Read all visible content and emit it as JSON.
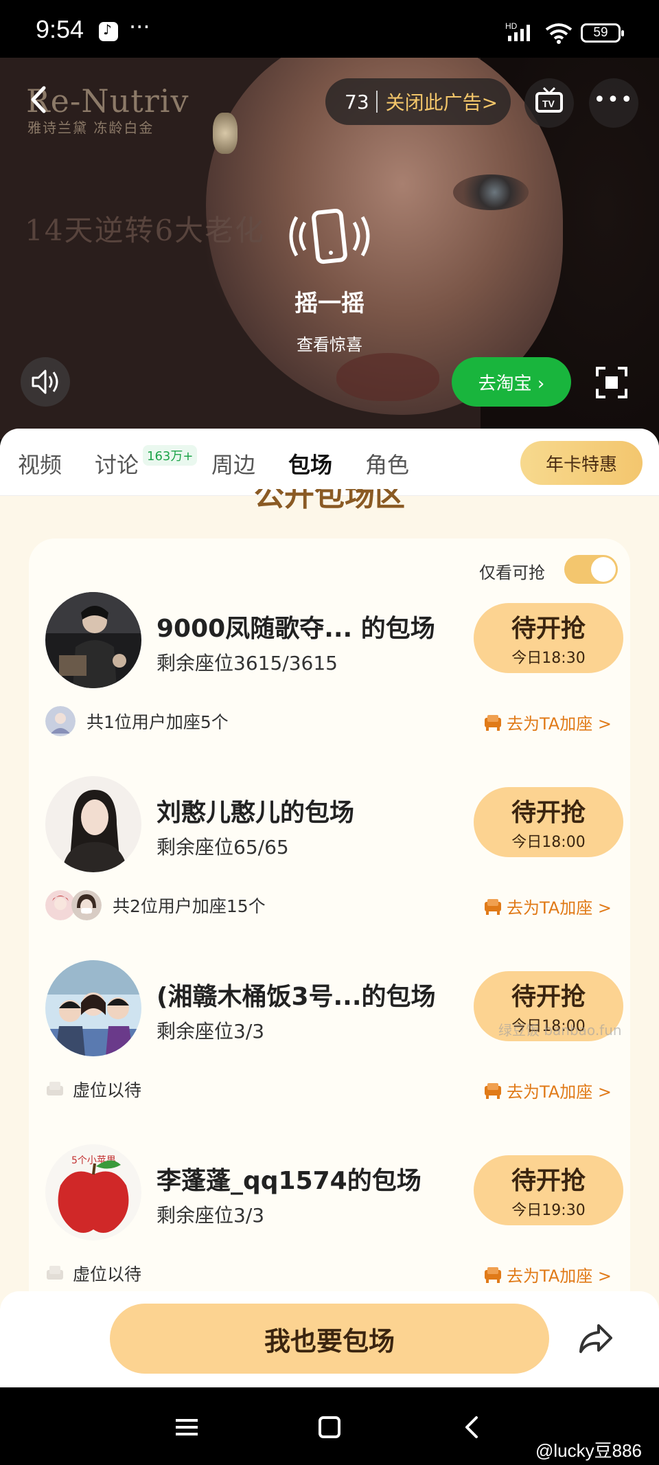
{
  "status_bar": {
    "time": "9:54",
    "battery": "59"
  },
  "ad": {
    "brand": "Re-Nutriv",
    "brand_sub": "雅诗兰黛 冻龄白金",
    "slogan": "14天逆转6大老化",
    "countdown": "73",
    "close_label": "关闭此广告>",
    "shake_title": "摇一摇",
    "shake_sub": "查看惊喜",
    "taobao_label": "去淘宝 ›"
  },
  "tabs": [
    {
      "label": "视频"
    },
    {
      "label": "讨论",
      "badge": "163万+"
    },
    {
      "label": "周边"
    },
    {
      "label": "包场"
    },
    {
      "label": "角色"
    }
  ],
  "annual_btn": "年卡特惠",
  "section_title": "公开包场区",
  "only_available": "仅看可抢",
  "items": [
    {
      "title": "9000凤随歌夺... 的包场",
      "seats": "剩余座位3615/3615",
      "btn_main": "待开抢",
      "btn_time": "今日18:30",
      "users_text": "共1位用户加座5个",
      "add_link": "去为TA加座 >"
    },
    {
      "title": "刘憨儿憨儿的包场",
      "seats": "剩余座位65/65",
      "btn_main": "待开抢",
      "btn_time": "今日18:00",
      "users_text": "共2位用户加座15个",
      "add_link": "去为TA加座 >"
    },
    {
      "title": "(湘赣木桶饭3号...的包场",
      "seats": "剩余座位3/3",
      "btn_main": "待开抢",
      "btn_time": "今日18:00",
      "users_text": "虚位以待",
      "add_link": "去为TA加座 >"
    },
    {
      "title": "李蓬蓬_qq1574的包场",
      "seats": "剩余座位3/3",
      "btn_main": "待开抢",
      "btn_time": "今日19:30",
      "users_text": "虚位以待",
      "add_link": "去为TA加座 >"
    }
  ],
  "watermark": "绿豆饭 banbao.fun",
  "bottom": {
    "main_btn": "我也要包场"
  },
  "credit": "@lucky豆886",
  "colors": {
    "accent": "#fcd391",
    "link": "#e07a18",
    "taobao": "#19b53d"
  }
}
